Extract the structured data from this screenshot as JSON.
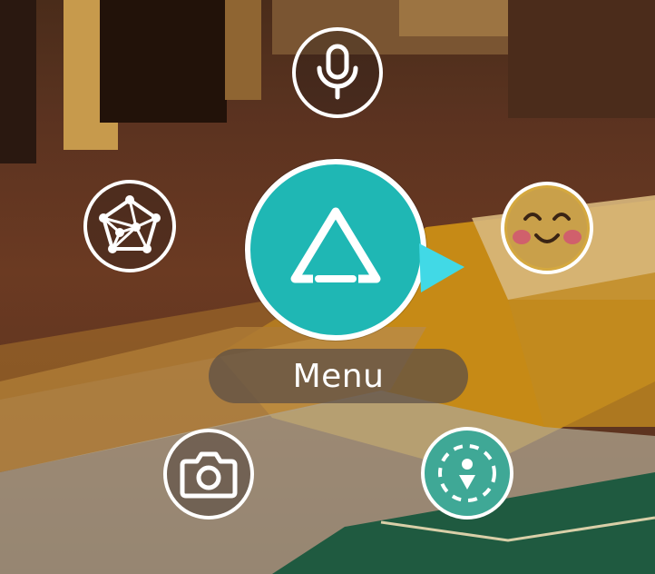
{
  "menu": {
    "label": "Menu",
    "center_button_icon": "triangle-logo-icon",
    "center_color": "#1fb7b4",
    "items": [
      {
        "id": "voice",
        "icon": "microphone-icon"
      },
      {
        "id": "network",
        "icon": "network-icon"
      },
      {
        "id": "emote",
        "icon": "smiling-face-icon"
      },
      {
        "id": "camera",
        "icon": "camera-icon"
      },
      {
        "id": "teleport",
        "icon": "compass-marker-icon",
        "color": "#3fa896"
      }
    ]
  }
}
